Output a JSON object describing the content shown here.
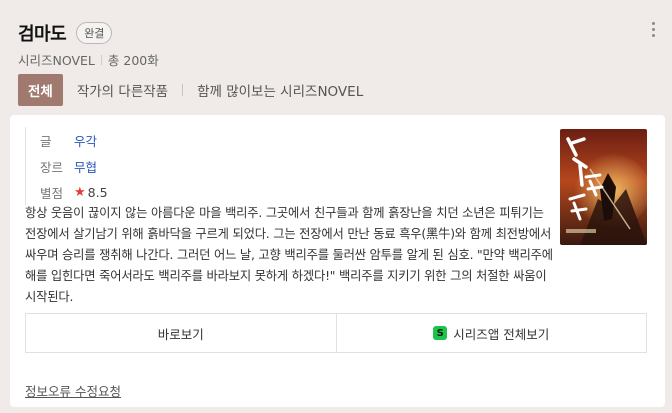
{
  "header": {
    "title": "검마도",
    "badge": "완결",
    "publisher": "시리즈NOVEL",
    "episodes": "총 200화"
  },
  "tabs": {
    "active": "전체",
    "items": [
      "작가의 다른작품",
      "함께 많이보는 시리즈NOVEL"
    ]
  },
  "info": {
    "author_label": "글",
    "author": "우각",
    "genre_label": "장르",
    "genre": "무협",
    "rating_label": "별점",
    "rating": "8.5"
  },
  "description": "항상 웃음이 끊이지 않는 아름다운 마을 백리주. 그곳에서 친구들과 함께 흙장난을 치던 소년은 피튀기는 전장에서 살기남기 위해 흙바닥을 구르게 되었다. 그는 전장에서 만난 동료 흑우(黑牛)와 함께 최전방에서 싸우며 승리를 쟁취해 나간다. 그러던 어느 날, 고향 백리주를 둘러싼 암투를 알게 된 심호. \"만약 백리주에 해를 입힌다면 죽어서라도 백리주를 바라보지 못하게 하겠다!\" 백리주를 지키기 위한 그의 처절한 싸움이 시작된다.",
  "actions": {
    "view": "바로보기",
    "series_app": "시리즈앱 전체보기",
    "series_logo": "S"
  },
  "report": "정보오류 수정요청",
  "colors": {
    "tab_active_bg": "#a07a6f",
    "link_blue": "#2856b8",
    "star_red": "#e53935",
    "series_green": "#1dc44b"
  }
}
